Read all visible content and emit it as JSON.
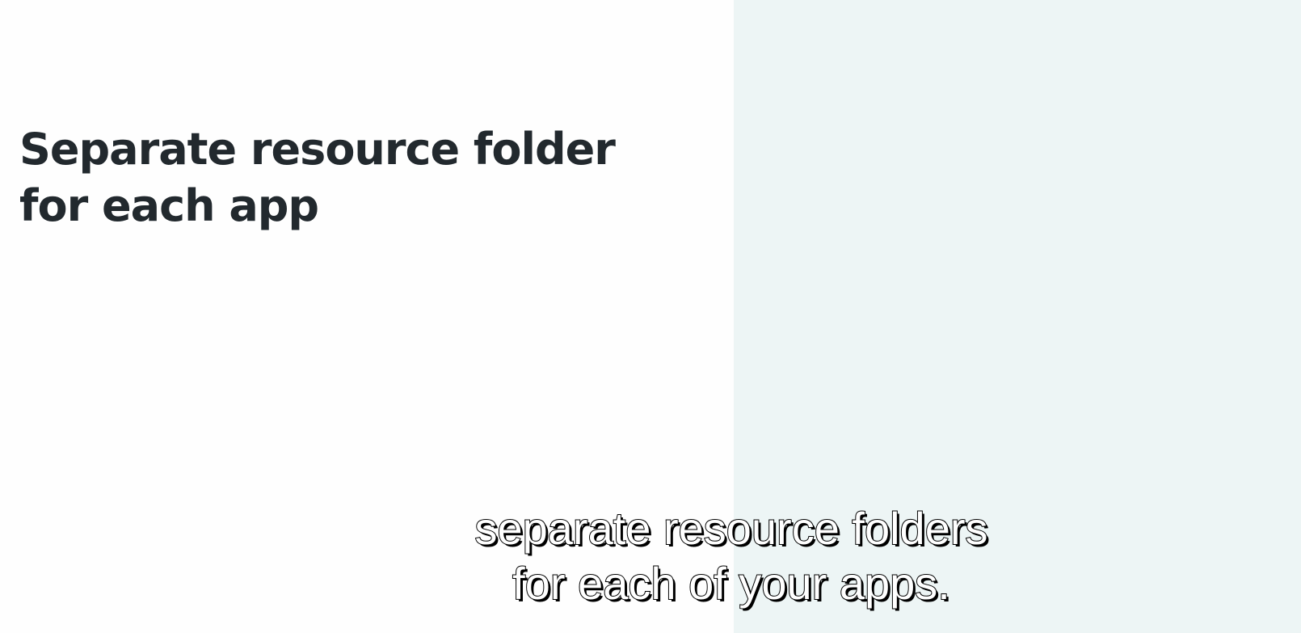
{
  "slide": {
    "title_lines": [
      "Separate resource folder",
      "for each app"
    ]
  },
  "caption": {
    "lines": [
      "separate resource folders",
      "for each of your apps."
    ]
  },
  "colors": {
    "left_background": "#fefefe",
    "right_background": "#edf5f5",
    "title_text": "#22292e",
    "caption_fill": "#ffffff",
    "caption_outline": "#000000"
  }
}
